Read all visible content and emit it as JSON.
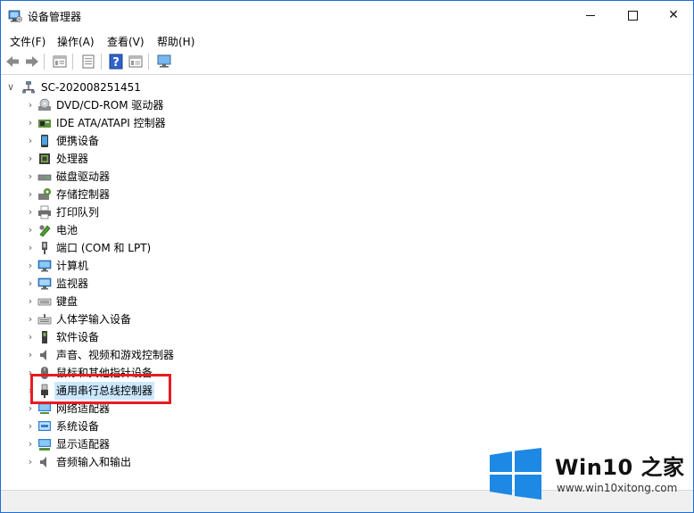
{
  "window": {
    "title": "设备管理器",
    "title_icon": "device-manager-icon"
  },
  "window_controls": {
    "minimize": "minimize",
    "maximize": "maximize",
    "close": "✕"
  },
  "menu": [
    "文件(F)",
    "操作(A)",
    "查看(V)",
    "帮助(H)"
  ],
  "toolbar": [
    "back-icon",
    "forward-icon",
    "properties-icon",
    "update-driver-icon",
    "help-icon",
    "view-icon",
    "monitor-icon"
  ],
  "tree": {
    "root": {
      "label": "SC-202008251451",
      "expanded": true,
      "icon": "computer-icon"
    },
    "items": [
      {
        "label": "DVD/CD-ROM 驱动器",
        "icon": "dvd-drive-icon"
      },
      {
        "label": "IDE ATA/ATAPI 控制器",
        "icon": "ide-controller-icon"
      },
      {
        "label": "便携设备",
        "icon": "portable-device-icon"
      },
      {
        "label": "处理器",
        "icon": "processor-icon"
      },
      {
        "label": "磁盘驱动器",
        "icon": "disk-drive-icon"
      },
      {
        "label": "存储控制器",
        "icon": "storage-controller-icon"
      },
      {
        "label": "打印队列",
        "icon": "printer-icon"
      },
      {
        "label": "电池",
        "icon": "battery-icon"
      },
      {
        "label": "端口 (COM 和 LPT)",
        "icon": "port-icon"
      },
      {
        "label": "计算机",
        "icon": "computer-icon"
      },
      {
        "label": "监视器",
        "icon": "monitor-icon"
      },
      {
        "label": "键盘",
        "icon": "keyboard-icon"
      },
      {
        "label": "人体学输入设备",
        "icon": "hid-icon"
      },
      {
        "label": "软件设备",
        "icon": "software-device-icon"
      },
      {
        "label": "声音、视频和游戏控制器",
        "icon": "audio-icon"
      },
      {
        "label": "鼠标和其他指针设备",
        "icon": "mouse-icon"
      },
      {
        "label": "通用串行总线控制器",
        "icon": "usb-icon",
        "selected": true
      },
      {
        "label": "网络适配器",
        "icon": "network-adapter-icon"
      },
      {
        "label": "系统设备",
        "icon": "system-device-icon"
      },
      {
        "label": "显示适配器",
        "icon": "display-adapter-icon"
      },
      {
        "label": "音频输入和输出",
        "icon": "audio-io-icon"
      }
    ]
  },
  "watermark": {
    "title": "Win10 之家",
    "subtitle": "www.win10xitong.com"
  },
  "colors": {
    "highlight_border": "#e81b23",
    "selection_bg": "#cce8ff",
    "win_blue": "#1e88e5"
  }
}
